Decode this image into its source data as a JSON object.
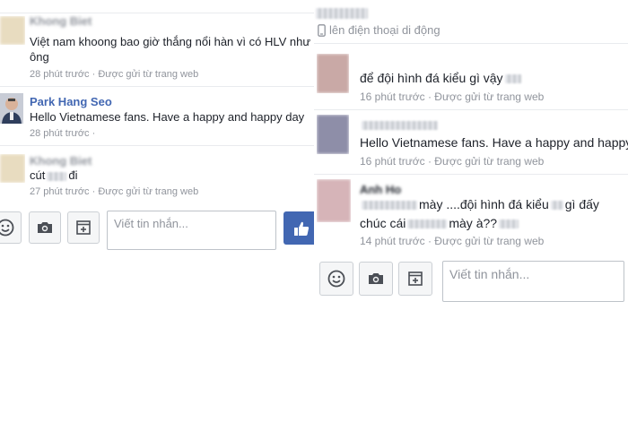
{
  "left": {
    "messages": [
      {
        "sender": "Khong Biet",
        "text_line1": "Việt nam khoong bao giờ thắng nổi hàn vì có HLV như",
        "text_line2": "ông",
        "time": "28 phút trước",
        "via": "Được gửi từ trang web",
        "avatar_color": "#e8dcc0"
      },
      {
        "sender": "Park Hang Seo",
        "text": "Hello Vietnamese fans. Have a happy and happy day",
        "time": "28 phút trước",
        "avatar_color": "#6b7fa0"
      },
      {
        "sender": "Khong Biet",
        "text_pre": "cút",
        "text_post": "đi",
        "time": "27 phút trước",
        "via": "Được gửi từ trang web",
        "avatar_color": "#e8dcc0"
      }
    ],
    "composer": {
      "placeholder": "Viết tin nhắn...",
      "emoji_icon": "smiley-icon",
      "camera_icon": "camera-icon",
      "sticker_icon": "sticker-icon",
      "like_icon": "thumbs-up-icon",
      "like_color": "#4267b2"
    }
  },
  "right": {
    "header": {
      "device_icon": "mobile-phone-icon",
      "status": "lên điện thoại di động"
    },
    "messages": [
      {
        "text": "để đội hình đá kiểu gì vậy",
        "time": "16 phút trước",
        "via": "Được gửi từ trang web",
        "avatar_color": "#c9a9a6"
      },
      {
        "text": "Hello Vietnamese fans. Have a happy and happy",
        "time": "16 phút trước",
        "via": "Được gửi từ trang web",
        "avatar_color": "#8e8ea8"
      },
      {
        "sender": "Anh Ho",
        "text1_a": "mày ....đội hình đá kiểu",
        "text1_b": "gì đấy",
        "text2_a": "chúc cái",
        "text2_b": "mày à??",
        "time": "14 phút trước",
        "via": "Được gửi từ trang web",
        "avatar_color": "#d6b4b8"
      }
    ],
    "composer": {
      "placeholder": "Viết tin nhắn...",
      "emoji_icon": "smiley-icon",
      "camera_icon": "camera-icon",
      "sticker_icon": "sticker-icon"
    }
  },
  "colors": {
    "link_blue": "#4267b2",
    "meta_gray": "#90949c",
    "divider": "#e9ebee"
  }
}
